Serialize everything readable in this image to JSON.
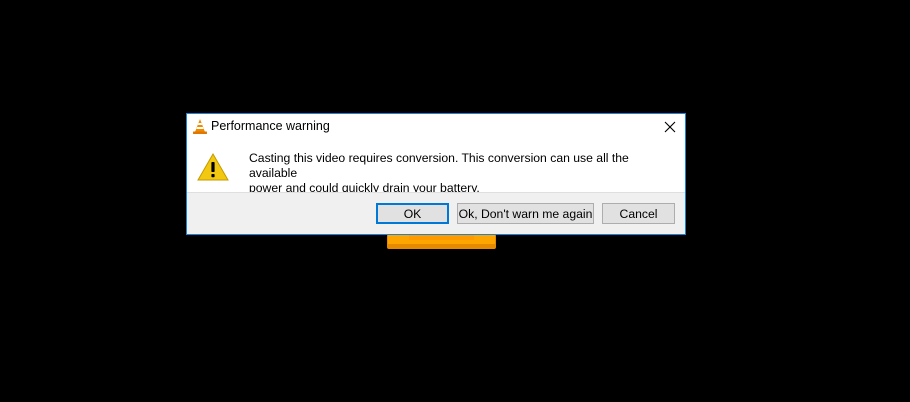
{
  "dialog": {
    "title": "Performance warning",
    "title_icon": "vlc-cone-icon",
    "close_icon": "close-icon",
    "message_icon": "warning-icon",
    "message_line1": "Casting this video requires conversion. This conversion can use all the available",
    "message_line2": "power and could quickly drain your battery.",
    "buttons": {
      "ok": "OK",
      "dont_warn": "Ok, Don't warn me again",
      "cancel": "Cancel"
    },
    "default_button": "ok"
  },
  "colors": {
    "background": "#000000",
    "dialog_border": "#1883d7",
    "default_button_border": "#0078d7",
    "vlc_orange": "#f5a000"
  }
}
